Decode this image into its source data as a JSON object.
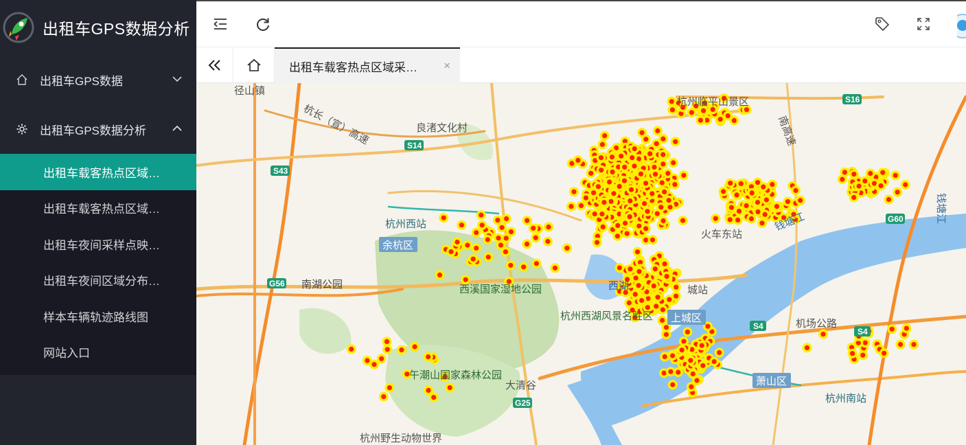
{
  "app": {
    "title": "出租车GPS数据分析"
  },
  "sidebar": {
    "groups": [
      {
        "label": "出租车GPS数据",
        "icon": "home-icon",
        "expanded": false
      },
      {
        "label": "出租车GPS数据分析",
        "icon": "gear-icon",
        "expanded": true
      }
    ],
    "items": [
      {
        "label": "出租车载客热点区域…",
        "active": true
      },
      {
        "label": "出租车载客热点区域…",
        "active": false
      },
      {
        "label": "出租车夜间采样点映…",
        "active": false
      },
      {
        "label": "出租车夜间区域分布…",
        "active": false
      },
      {
        "label": "样本车辆轨迹路线图",
        "active": false
      },
      {
        "label": "网站入口",
        "active": false
      }
    ]
  },
  "header": {
    "icons": [
      "menu-fold-icon",
      "refresh-icon",
      "tag-icon",
      "fullscreen-icon",
      "avatar"
    ]
  },
  "tabs": {
    "active_label": "出租车载客热点区域采…",
    "close": "×"
  },
  "map": {
    "labels": {
      "jingshan": "径山镇",
      "hangchang": "杭长（宣）高速",
      "liangzhu": "良渚文化村",
      "s14": "S14",
      "s43": "S43",
      "hangzhou_west": "杭州西站",
      "yuhang": "余杭区",
      "nanhu": "南湖公园",
      "g56": "G56",
      "xixi": "西溪国家湿地公园",
      "hangzhou_xihu": "杭州西湖风景名胜区",
      "wuchao": "午潮山国家森林公园",
      "daqinggu": "大清谷",
      "g25": "G25",
      "wildlife": "杭州野生动物世界",
      "linping": "杭州临平山景区",
      "s16": "S16",
      "nanhu_gaosu": "南高速",
      "qiantangjiang": "钱塘江",
      "g60": "G60",
      "shangcheng": "上城区",
      "jichang": "机场公路",
      "s4a": "S4",
      "s4b": "S4",
      "xiaoshan": "萧山区",
      "hangzhou_south": "杭州南站",
      "qiantang_right": "钱塘江",
      "huochezhan": "火车东站",
      "xihu": "西湖",
      "city_station": "城站"
    },
    "hotspot_color": "#ff2200",
    "hotspot_ring": "#ffee00",
    "river_color": "#8fc3ee",
    "park_color": "#c7dfb1"
  }
}
